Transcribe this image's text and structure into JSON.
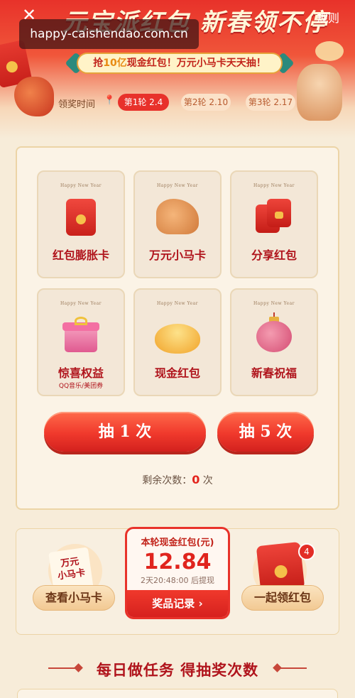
{
  "header": {
    "close_icon": "close-icon",
    "rules_label": "规则",
    "title": "元宝派红包 新春领不停",
    "url_banner": "happy-caishendao.com.cn",
    "promo_prefix": "抢",
    "promo_highlight": "10亿",
    "promo_suffix": "现金红包！万元小马卡天天抽！",
    "schedule_label": "领奖时间",
    "rounds": [
      {
        "label": "第1轮 2.4",
        "active": true
      },
      {
        "label": "第2轮 2.10",
        "active": false
      },
      {
        "label": "第3轮 2.17",
        "active": false
      }
    ]
  },
  "prizes": [
    {
      "tag": "Happy New Year",
      "title": "红包膨胀卡",
      "sub": "",
      "icon": "red-envelope-icon"
    },
    {
      "tag": "Happy New Year",
      "title": "万元小马卡",
      "sub": "",
      "icon": "horse-icon"
    },
    {
      "tag": "Happy New Year",
      "title": "分享红包",
      "sub": "",
      "icon": "share-envelope-icon"
    },
    {
      "tag": "Happy New Year",
      "title": "惊喜权益",
      "sub": "QQ音乐/美团券",
      "icon": "gift-box-icon"
    },
    {
      "tag": "Happy New Year",
      "title": "现金红包",
      "sub": "",
      "icon": "gold-ingot-icon"
    },
    {
      "tag": "Happy New Year",
      "title": "新春祝福",
      "sub": "",
      "icon": "lantern-icon"
    }
  ],
  "draw": {
    "draw_once_label": "抽 1 次",
    "draw_five_label": "抽 5 次",
    "remaining_prefix": "剩余次数：",
    "remaining_count": "0",
    "remaining_suffix": "次"
  },
  "cash": {
    "label": "本轮现金红包(元)",
    "amount": "12.84",
    "time_note": "2天20:48:00 后提现",
    "records_label": "奖品记录 ›"
  },
  "horse_card": {
    "badge_line1": "万元",
    "badge_line2": "小马卡",
    "button_label": "查看小马卡"
  },
  "share": {
    "badge_count": "4",
    "button_label": "一起领红包"
  },
  "tasks": {
    "title": "每日做任务  得抽奖次数"
  },
  "colors": {
    "brand_red": "#e8322a",
    "accent_gold": "#f5c04a",
    "background": "#f7ecd9"
  }
}
